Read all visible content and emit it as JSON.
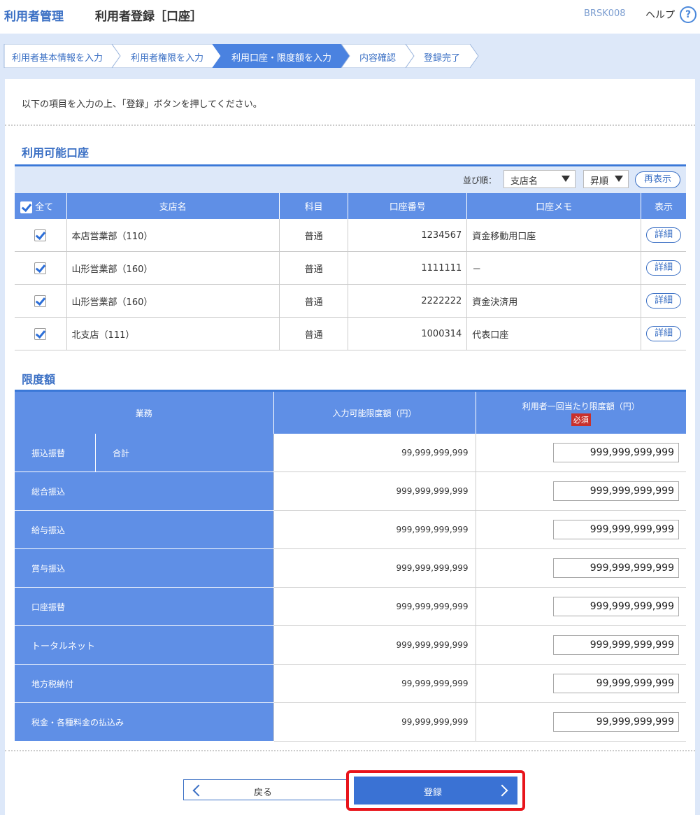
{
  "header": {
    "section": "利用者管理",
    "title": "利用者登録［口座］",
    "screen_code": "BRSK008",
    "help_label": "ヘルプ",
    "help_icon": "?"
  },
  "steps": [
    {
      "label": "利用者基本情報を入力",
      "active": false
    },
    {
      "label": "利用者権限を入力",
      "active": false
    },
    {
      "label": "利用口座・限度額を入力",
      "active": true
    },
    {
      "label": "内容確認",
      "active": false
    },
    {
      "label": "登録完了",
      "active": false
    }
  ],
  "intro": "以下の項目を入力の上、「登録」ボタンを押してください。",
  "accounts": {
    "title": "利用可能口座",
    "sort_label": "並び順：",
    "sort_field": "支店名",
    "sort_order": "昇順",
    "redisplay": "再表示",
    "headers": {
      "all": "全て",
      "branch": "支店名",
      "subject": "科目",
      "number": "口座番号",
      "memo": "口座メモ",
      "display": "表示"
    },
    "detail_label": "詳細",
    "rows": [
      {
        "branch": "本店営業部（110）",
        "subject": "普通",
        "number": "1234567",
        "memo": "資金移動用口座"
      },
      {
        "branch": "山形営業部（160）",
        "subject": "普通",
        "number": "1111111",
        "memo": "－"
      },
      {
        "branch": "山形営業部（160）",
        "subject": "普通",
        "number": "2222222",
        "memo": "資金決済用"
      },
      {
        "branch": "北支店（111）",
        "subject": "普通",
        "number": "1000314",
        "memo": "代表口座"
      }
    ]
  },
  "limits": {
    "title": "限度額",
    "headers": {
      "business": "業務",
      "available": "入力可能限度額（円）",
      "per_use": "利用者一回当たり限度額（円）",
      "required": "必須"
    },
    "rows": [
      {
        "business": "振込振替",
        "sub": "合計",
        "available": "99,999,999,999",
        "value": "999,999,999,999"
      },
      {
        "business": "総合振込",
        "available": "999,999,999,999",
        "value": "999,999,999,999"
      },
      {
        "business": "給与振込",
        "available": "999,999,999,999",
        "value": "999,999,999,999"
      },
      {
        "business": "賞与振込",
        "available": "999,999,999,999",
        "value": "999,999,999,999"
      },
      {
        "business": "口座振替",
        "available": "999,999,999,999",
        "value": "999,999,999,999"
      },
      {
        "business": "トータルネット",
        "available": "999,999,999,999",
        "value": "999,999,999,999"
      },
      {
        "business": "地方税納付",
        "available": "99,999,999,999",
        "value": "99,999,999,999"
      },
      {
        "business": "税金・各種料金の払込み",
        "available": "99,999,999,999",
        "value": "99,999,999,999"
      }
    ]
  },
  "buttons": {
    "back": "戻る",
    "register": "登録"
  },
  "colors": {
    "accent": "#3a72d4",
    "header_blue": "#5f8fe6",
    "highlight": "#e8141b",
    "required": "#c9302c"
  }
}
